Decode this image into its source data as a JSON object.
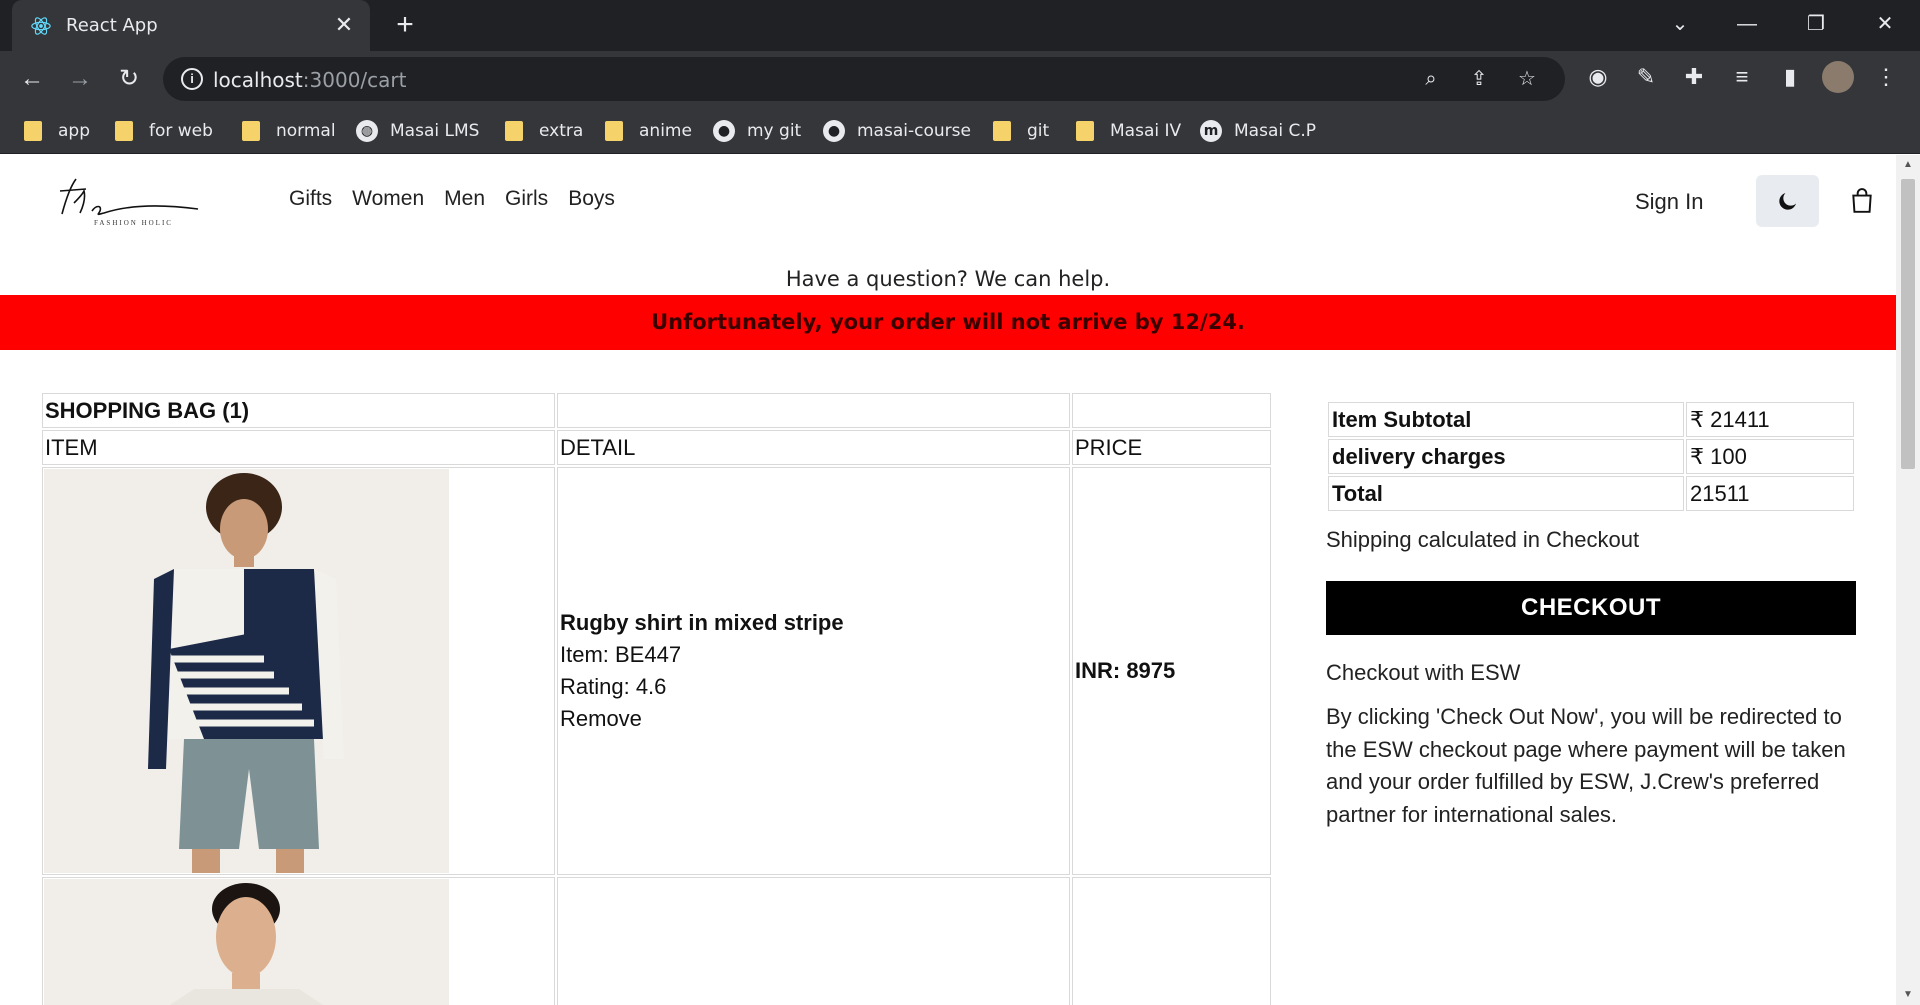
{
  "browser": {
    "tab_title": "React App",
    "url_host": "localhost",
    "url_path": ":3000/cart",
    "bookmarks": [
      {
        "label": "app",
        "icon": "folder-icon"
      },
      {
        "label": "for web",
        "icon": "folder-icon"
      },
      {
        "label": "normal",
        "icon": "folder-icon"
      },
      {
        "label": "Masai LMS",
        "icon": "globe-icon"
      },
      {
        "label": "extra",
        "icon": "folder-icon"
      },
      {
        "label": "anime",
        "icon": "folder-icon"
      },
      {
        "label": "my git",
        "icon": "github-icon"
      },
      {
        "label": "masai-course",
        "icon": "github-icon"
      },
      {
        "label": "git",
        "icon": "folder-icon"
      },
      {
        "label": "Masai IV",
        "icon": "folder-icon"
      },
      {
        "label": "Masai C.P",
        "icon": "m-icon"
      }
    ]
  },
  "header": {
    "nav": [
      "Gifts",
      "Women",
      "Men",
      "Girls",
      "Boys"
    ],
    "sign_in": "Sign In"
  },
  "help_text": "Have a question? We can help.",
  "banner_text": "Unfortunately, your order will not arrive by 12/24.",
  "cart": {
    "title": "SHOPPING BAG (1)",
    "columns": [
      "ITEM",
      "DETAIL",
      "PRICE"
    ],
    "items": [
      {
        "name": "Rugby shirt in mixed stripe",
        "item": "Item: BE447",
        "rating": "Rating: 4.6",
        "remove": "Remove",
        "price": "INR: 8975"
      }
    ]
  },
  "summary": {
    "rows": [
      {
        "label": "Item Subtotal",
        "value": "₹ 21411"
      },
      {
        "label": "delivery charges",
        "value": "₹ 100"
      },
      {
        "label": "Total",
        "value": "21511"
      }
    ],
    "shipping_note": "Shipping calculated in Checkout",
    "checkout_label": "CHECKOUT",
    "esw_title": "Checkout with ESW",
    "esw_text": "By clicking 'Check Out Now', you will be redirected to the ESW checkout page where payment will be taken and your order fulfilled by ESW, J.Crew's preferred partner for international sales."
  },
  "colors": {
    "banner": "#ff0000",
    "checkout": "#000000",
    "chrome_dark": "#202124",
    "chrome_mid": "#35363a"
  }
}
